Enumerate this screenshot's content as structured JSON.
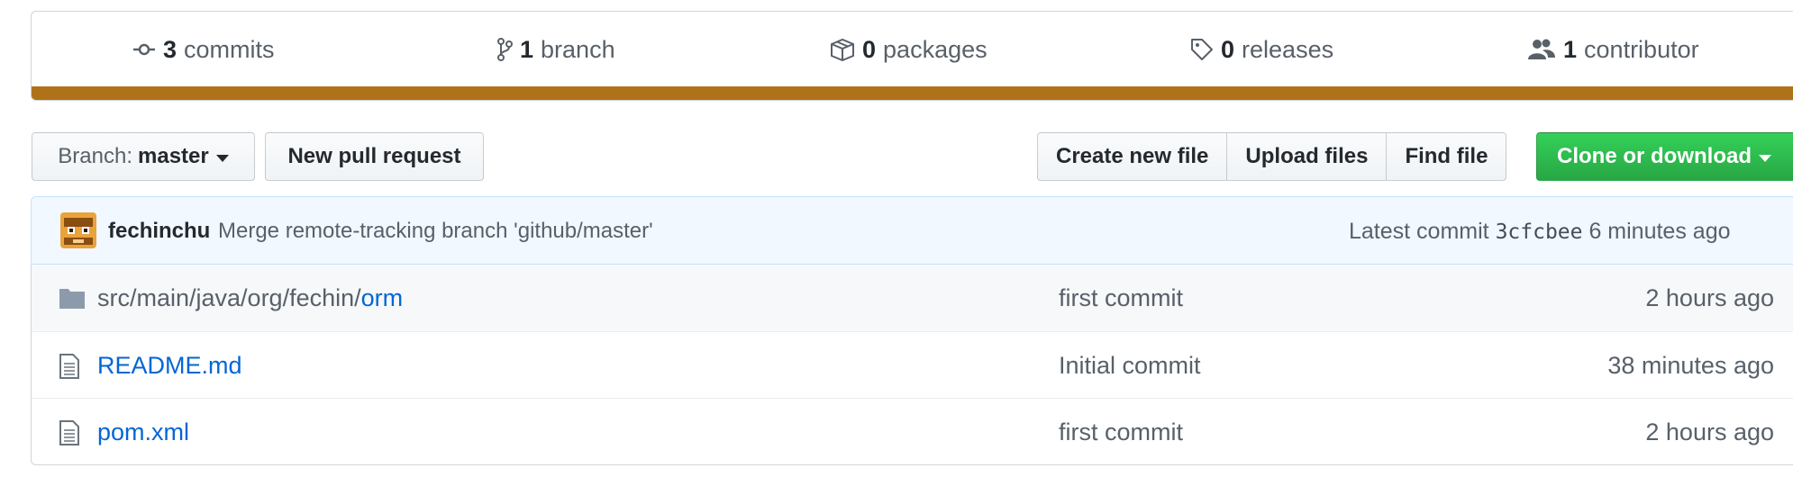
{
  "summary": {
    "commits": {
      "count": "3",
      "label": "commits",
      "icon": "git-commit-icon"
    },
    "branches": {
      "count": "1",
      "label": "branch",
      "icon": "git-branch-icon"
    },
    "packages": {
      "count": "0",
      "label": "packages",
      "icon": "package-icon"
    },
    "releases": {
      "count": "0",
      "label": "releases",
      "icon": "tag-icon"
    },
    "contributors": {
      "count": "1",
      "label": "contributor",
      "icon": "people-icon"
    },
    "language_color": "#b07219"
  },
  "toolbar": {
    "branch_prefix": "Branch:",
    "branch_name": "master",
    "new_pr": "New pull request",
    "create_file": "Create new file",
    "upload_files": "Upload files",
    "find_file": "Find file",
    "clone": "Clone or download"
  },
  "latest_commit": {
    "author": "fechinchu",
    "message": "Merge remote-tracking branch 'github/master'",
    "prefix": "Latest commit",
    "sha": "3cfcbee",
    "age": "6 minutes ago"
  },
  "files": [
    {
      "type": "directory",
      "path_prefix": "src/main/java/org/fechin/",
      "name": "orm",
      "message": "first commit",
      "age": "2 hours ago"
    },
    {
      "type": "file",
      "path_prefix": "",
      "name": "README.md",
      "message": "Initial commit",
      "age": "38 minutes ago"
    },
    {
      "type": "file",
      "path_prefix": "",
      "name": "pom.xml",
      "message": "first commit",
      "age": "2 hours ago"
    }
  ]
}
